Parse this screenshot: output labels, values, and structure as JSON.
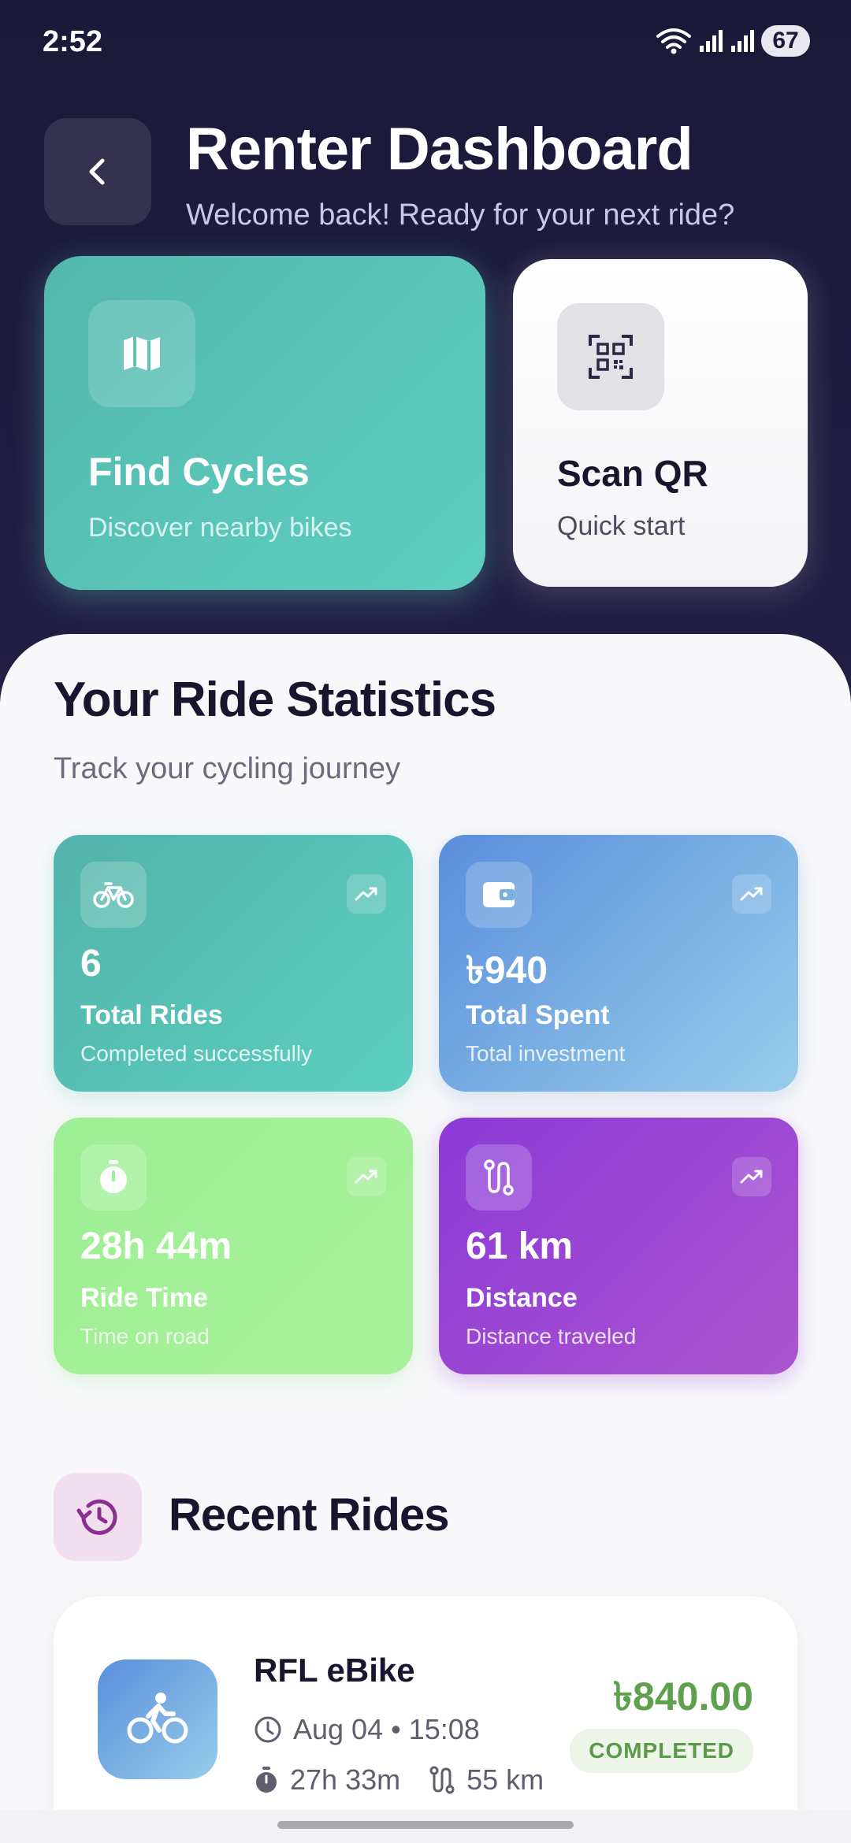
{
  "status_bar": {
    "time": "2:52",
    "battery": "67"
  },
  "header": {
    "title": "Renter Dashboard",
    "subtitle": "Welcome back! Ready for your next ride?"
  },
  "quick_actions": {
    "find": {
      "title": "Find Cycles",
      "subtitle": "Discover nearby bikes",
      "icon": "map-icon"
    },
    "scan": {
      "title": "Scan QR",
      "subtitle": "Quick start",
      "icon": "qr-code-icon"
    }
  },
  "stats_section": {
    "title": "Your Ride Statistics",
    "subtitle": "Track your cycling journey",
    "items": [
      {
        "value": "6",
        "label": "Total Rides",
        "desc": "Completed successfully",
        "icon": "bicycle-icon",
        "color": "#53b7ad"
      },
      {
        "value": "৳940",
        "label": "Total Spent",
        "desc": "Total investment",
        "icon": "wallet-icon",
        "color": "#5a8edc"
      },
      {
        "value": "28h 44m",
        "label": "Ride Time",
        "desc": "Time on road",
        "icon": "stopwatch-icon",
        "color": "#9cef94"
      },
      {
        "value": "61 km",
        "label": "Distance",
        "desc": "Distance traveled",
        "icon": "route-icon",
        "color": "#8a3ad8"
      }
    ]
  },
  "recent": {
    "title": "Recent Rides",
    "rides": [
      {
        "name": "RFL eBike",
        "date": "Aug 04 • 15:08",
        "duration": "27h 33m",
        "distance": "55 km",
        "price": "৳840.00",
        "status": "COMPLETED"
      }
    ]
  }
}
